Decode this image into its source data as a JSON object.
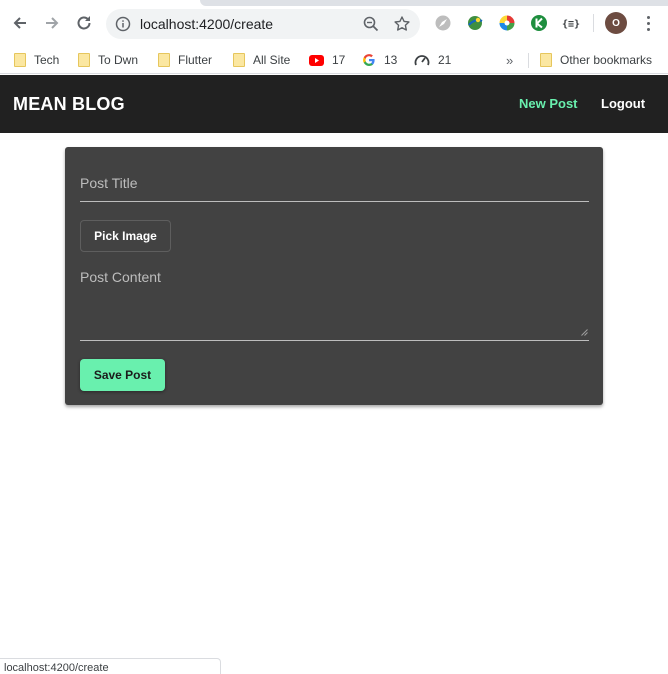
{
  "browser": {
    "url": "localhost:4200/create",
    "bookmarks": [
      {
        "label": "Tech",
        "icon": "folder-icon"
      },
      {
        "label": "To Dwn",
        "icon": "folder-icon"
      },
      {
        "label": "Flutter",
        "icon": "folder-icon"
      },
      {
        "label": "All Site",
        "icon": "folder-icon"
      },
      {
        "label": "17",
        "icon": "youtube-icon"
      },
      {
        "label": "13",
        "icon": "google-icon"
      },
      {
        "label": "21",
        "icon": "speedometer-icon"
      }
    ],
    "other_bookmarks": "Other bookmarks",
    "overflow": "»",
    "profile_initial": "O",
    "status_url": "localhost:4200/create"
  },
  "app": {
    "brand": "MEAN BLOG",
    "nav": [
      {
        "label": "New Post",
        "active": true
      },
      {
        "label": "Logout",
        "active": false
      }
    ],
    "accent_color": "#69f0ae",
    "header_color": "#212121",
    "card_color": "#424242"
  },
  "form": {
    "title_placeholder": "Post Title",
    "title_value": "",
    "pick_image_label": "Pick Image",
    "content_placeholder": "Post Content",
    "content_value": "",
    "save_label": "Save Post"
  }
}
